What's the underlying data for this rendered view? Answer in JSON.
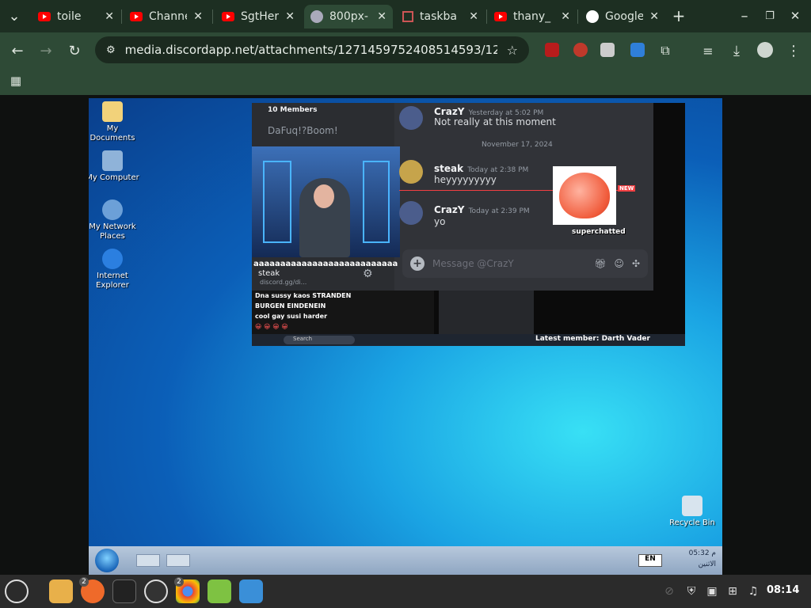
{
  "tabs": [
    {
      "label": "toile",
      "icon": "youtube-icon"
    },
    {
      "label": "Channe",
      "icon": "youtube-icon"
    },
    {
      "label": "SgtHer",
      "icon": "youtube-icon"
    },
    {
      "label": "800px-",
      "icon": "image-icon",
      "active": true
    },
    {
      "label": "taskba",
      "icon": "page-icon"
    },
    {
      "label": "thany_",
      "icon": "youtube-icon"
    },
    {
      "label": "Google",
      "icon": "google-icon"
    }
  ],
  "toolbar": {
    "url": "media.discordapp.net/attachments/1271459752408514593/12767131..."
  },
  "desktop": {
    "icons": [
      {
        "label": "My Documents"
      },
      {
        "label": "My Computer"
      },
      {
        "label": "My Network Places"
      },
      {
        "label": "Internet Explorer"
      }
    ],
    "recycle_bin": "Recycle Bin",
    "taskbar_clock": "05:32 م",
    "taskbar_day": "الاثنين",
    "lang": "EN"
  },
  "discord": {
    "members": "10 Members",
    "channel_text": "DaFuq!?Boom!",
    "msg1": {
      "name": "CrazY",
      "time": "Yesterday at 5:02 PM",
      "text": "Not really at this moment"
    },
    "date_divider": "November 17, 2024",
    "msg2": {
      "name": "steak",
      "time": "Today at 2:38 PM",
      "text": "heyyyyyyyyy"
    },
    "msg3": {
      "name": "CrazY",
      "time": "Today at 2:39 PM",
      "text": "yo"
    },
    "new_badge": "NEW",
    "superchat": "superchatted",
    "placeholder": "Message @CrazY",
    "user_status": "steak",
    "overlay_text": "aaaaaaaaaaaaaaaaaaaaaaaaaaa",
    "discord_link": "discord.gg/di...",
    "chat_lines": [
      "Dna sussy kaos  STRANDEN",
      "BURGEN EINDENEIN",
      "cool gay susi  harder",
      "😀 😀 😀 😀"
    ],
    "latest_member": "Latest member: Darth Vader",
    "search": "Search"
  },
  "panel": {
    "clock": "08:14",
    "badge_firefox": "2",
    "badge_chrome": "2"
  }
}
